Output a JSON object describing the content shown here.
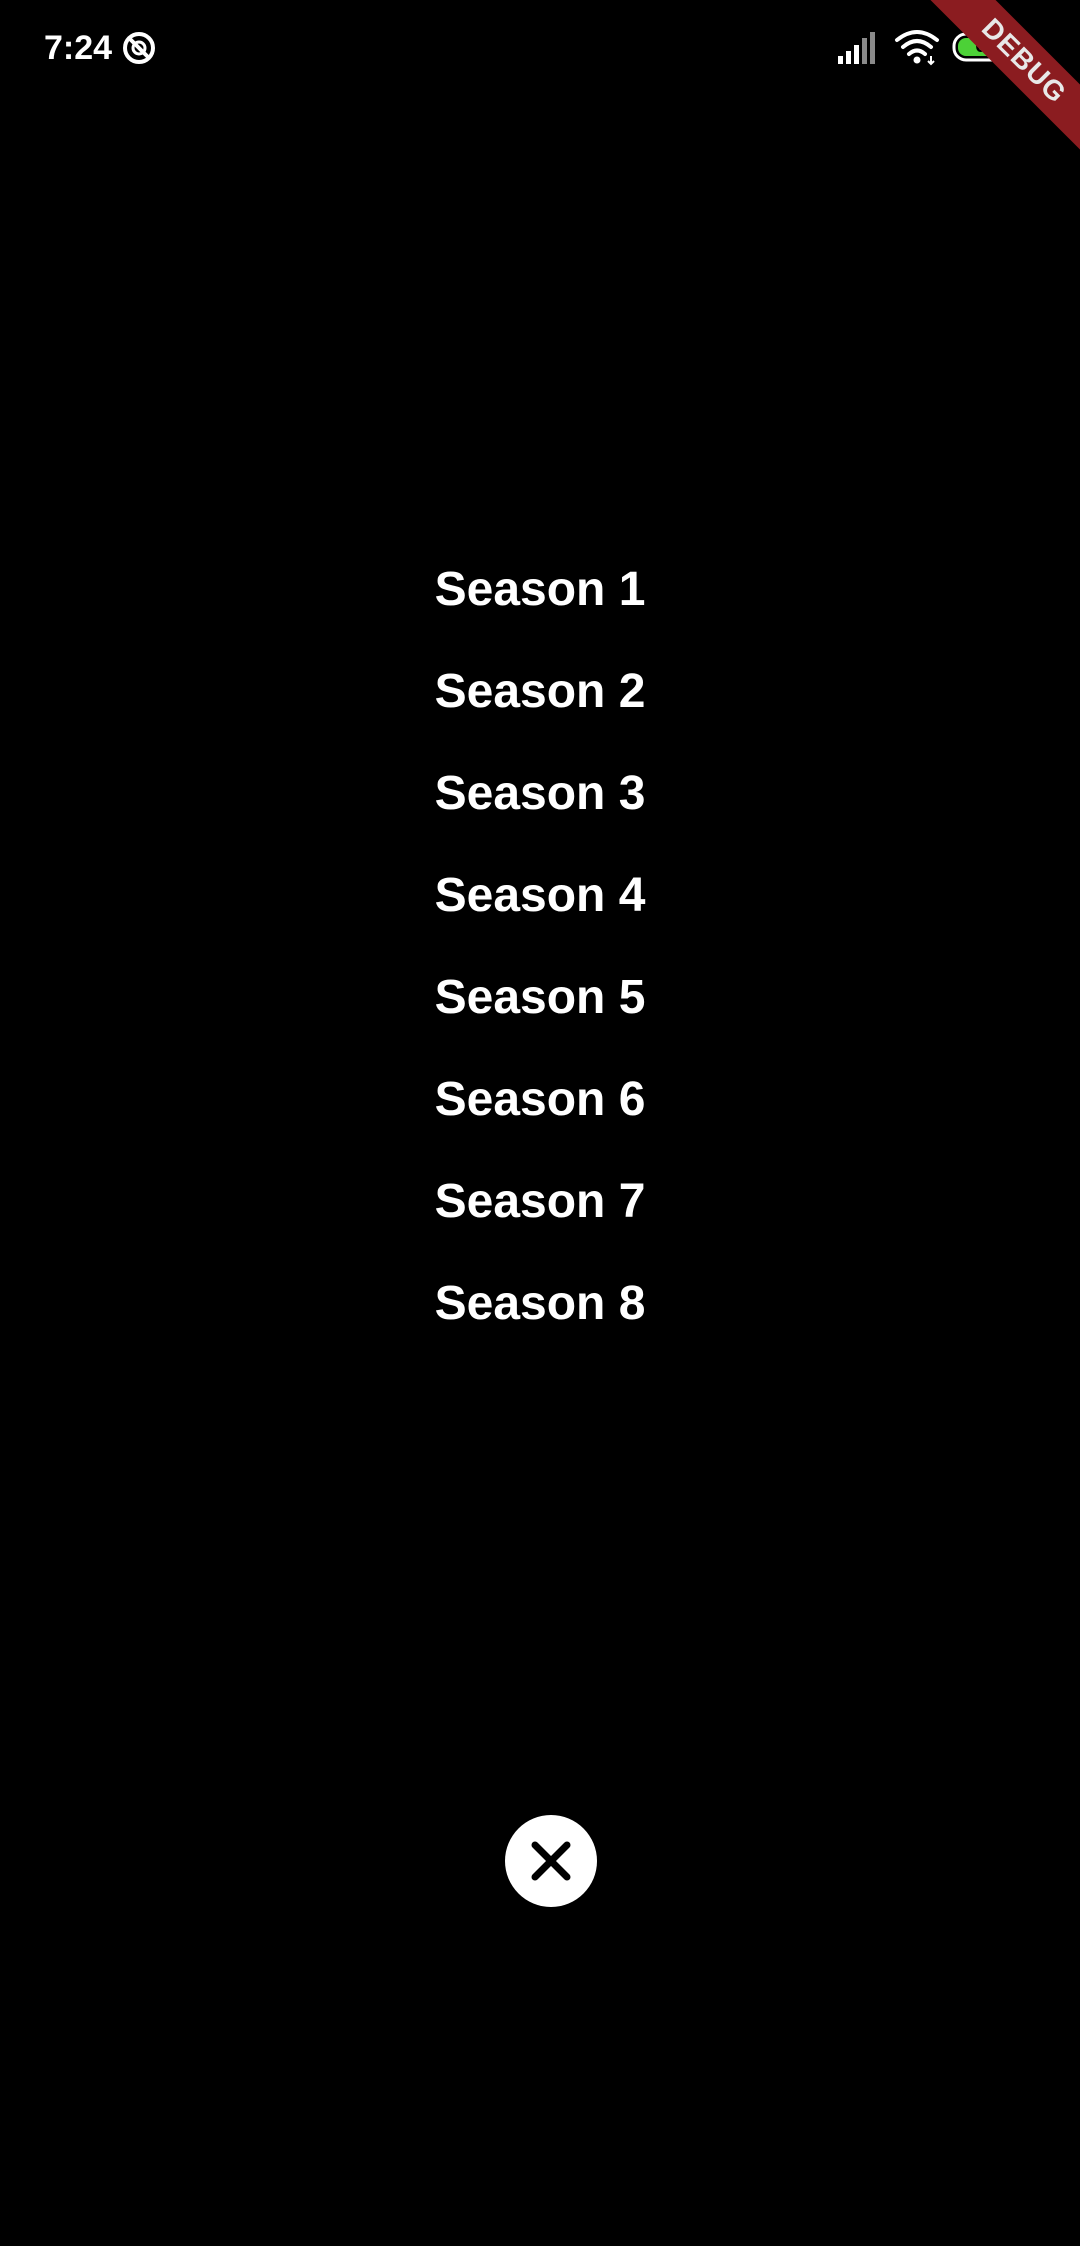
{
  "status_bar": {
    "time": "7:24",
    "battery_level": "63",
    "icons": [
      "do-not-disturb-icon",
      "signal-icon",
      "wifi-icon",
      "battery-icon"
    ]
  },
  "debug_banner": {
    "label": "DEBUG",
    "color": "#8b1c20"
  },
  "menu": {
    "items": [
      {
        "label": "Season 1"
      },
      {
        "label": "Season 2"
      },
      {
        "label": "Season 3"
      },
      {
        "label": "Season 4"
      },
      {
        "label": "Season 5"
      },
      {
        "label": "Season 6"
      },
      {
        "label": "Season 7"
      },
      {
        "label": "Season 8"
      }
    ]
  },
  "close_button": {
    "icon": "close-icon"
  },
  "colors": {
    "background": "#000000",
    "text": "#ffffff",
    "battery_fill": "#4cd137"
  }
}
